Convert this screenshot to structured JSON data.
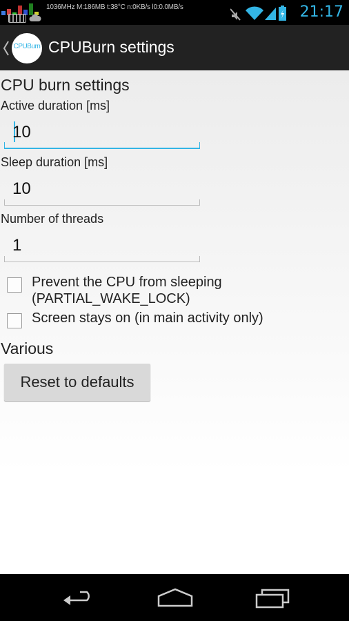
{
  "status_bar": {
    "stats": "1036MHz M:186MB t:38°C n:0KB/s l0:0.0MB/s",
    "time": "21:17",
    "icons": [
      "cpu-graph-icon",
      "keyboard-icon",
      "cloud-icon",
      "mute-icon",
      "wifi-icon",
      "signal-icon",
      "battery-charging-icon"
    ]
  },
  "action_bar": {
    "logo_text": "CPUBurn",
    "title": "CPUBurn settings"
  },
  "settings": {
    "cpu_header": "CPU burn settings",
    "active_duration": {
      "label": "Active duration [ms]",
      "value": "10"
    },
    "sleep_duration": {
      "label": "Sleep duration [ms]",
      "value": "10"
    },
    "threads": {
      "label": "Number of threads",
      "value": "1"
    },
    "wake_lock": {
      "label_line1": "Prevent the CPU from sleeping",
      "label_line2": "(PARTIAL_WAKE_LOCK)",
      "checked": false
    },
    "screen_on": {
      "label": "Screen stays on (in main activity only)",
      "checked": false
    },
    "various_header": "Various",
    "reset_button": "Reset to defaults"
  },
  "nav_bar": {
    "buttons": [
      "back-icon",
      "home-icon",
      "recent-apps-icon"
    ]
  },
  "colors": {
    "accent": "#33b5e5",
    "action_bar": "#222222"
  }
}
